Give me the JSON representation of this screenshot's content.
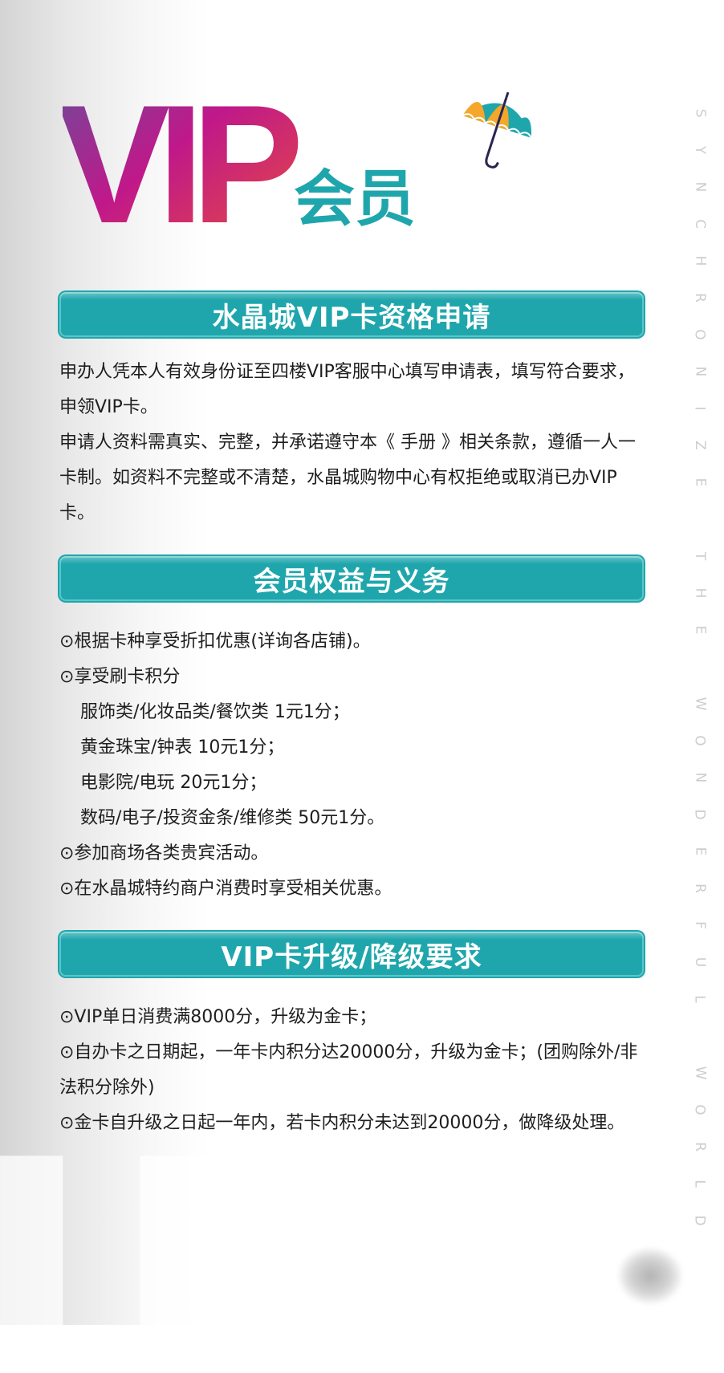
{
  "header": {
    "logo_text": "VIP",
    "logo_suffix": "会员"
  },
  "side_text": [
    "S",
    "Y",
    "N",
    "C",
    "H",
    "R",
    "O",
    "N",
    "I",
    "Z",
    "E",
    "",
    "T",
    "H",
    "E",
    "",
    "W",
    "O",
    "N",
    "D",
    "E",
    "R",
    "F",
    "U",
    "L",
    "",
    "W",
    "O",
    "R",
    "L",
    "D"
  ],
  "sections": [
    {
      "title": "水晶城VIP卡资格申请",
      "paragraphs": [
        "申办人凭本人有效身份证至四楼VIP客服中心填写申请表，填写符合要求，申领VIP卡。",
        "申请人资料需真实、完整，并承诺遵守本《 手册 》相关条款，遵循一人一卡制。如资料不完整或不清楚，水晶城购物中心有权拒绝或取消已办VIP卡。"
      ]
    },
    {
      "title": "会员权益与义务",
      "items": [
        "⊙根据卡种享受折扣优惠(详询各店铺)。",
        "⊙享受刷卡积分",
        "服饰类/化妆品类/餐饮类 1元1分；",
        "黄金珠宝/钟表 10元1分；",
        "电影院/电玩 20元1分；",
        "数码/电子/投资金条/维修类 50元1分。",
        "⊙参加商场各类贵宾活动。",
        "⊙在水晶城特约商户消费时享受相关优惠。"
      ]
    },
    {
      "title": "VIP卡升级/降级要求",
      "items": [
        "⊙VIP单日消费满8000分，升级为金卡；",
        "⊙自办卡之日期起，一年卡内积分达20000分，升级为金卡；(团购除外/非法积分除外)",
        "⊙金卡自升级之日起一年内，若卡内积分未达到20000分，做降级处理。"
      ]
    }
  ],
  "colors": {
    "banner": "#1fa6ac",
    "accent_teal": "#1fa6ac",
    "logo_gradient": [
      "#6b4c9a",
      "#c0188a",
      "#e8503a"
    ]
  }
}
